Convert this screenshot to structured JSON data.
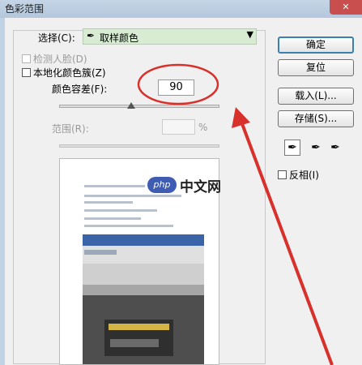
{
  "window": {
    "title": "色彩范围"
  },
  "select": {
    "label": "选择(C):",
    "value": "取样颜色",
    "icon": "eyedropper-icon"
  },
  "checks": {
    "face": {
      "label": "检测人脸(D)",
      "checked": false,
      "enabled": false
    },
    "localized": {
      "label": "本地化颜色簇(Z)",
      "checked": false,
      "enabled": true
    }
  },
  "fuzziness": {
    "label": "颜色容差(F):",
    "value": "90"
  },
  "range": {
    "label": "范围(R):",
    "unit": "%"
  },
  "buttons": {
    "ok": "确定",
    "reset": "复位",
    "load": "载入(L)...",
    "save": "存储(S)..."
  },
  "invert": {
    "label": "反相(I)",
    "checked": false
  },
  "watermark": {
    "logo": "php",
    "text": "中文网"
  },
  "colors": {
    "annotation_red": "#d8312b",
    "select_bg": "#d7ecd2"
  }
}
